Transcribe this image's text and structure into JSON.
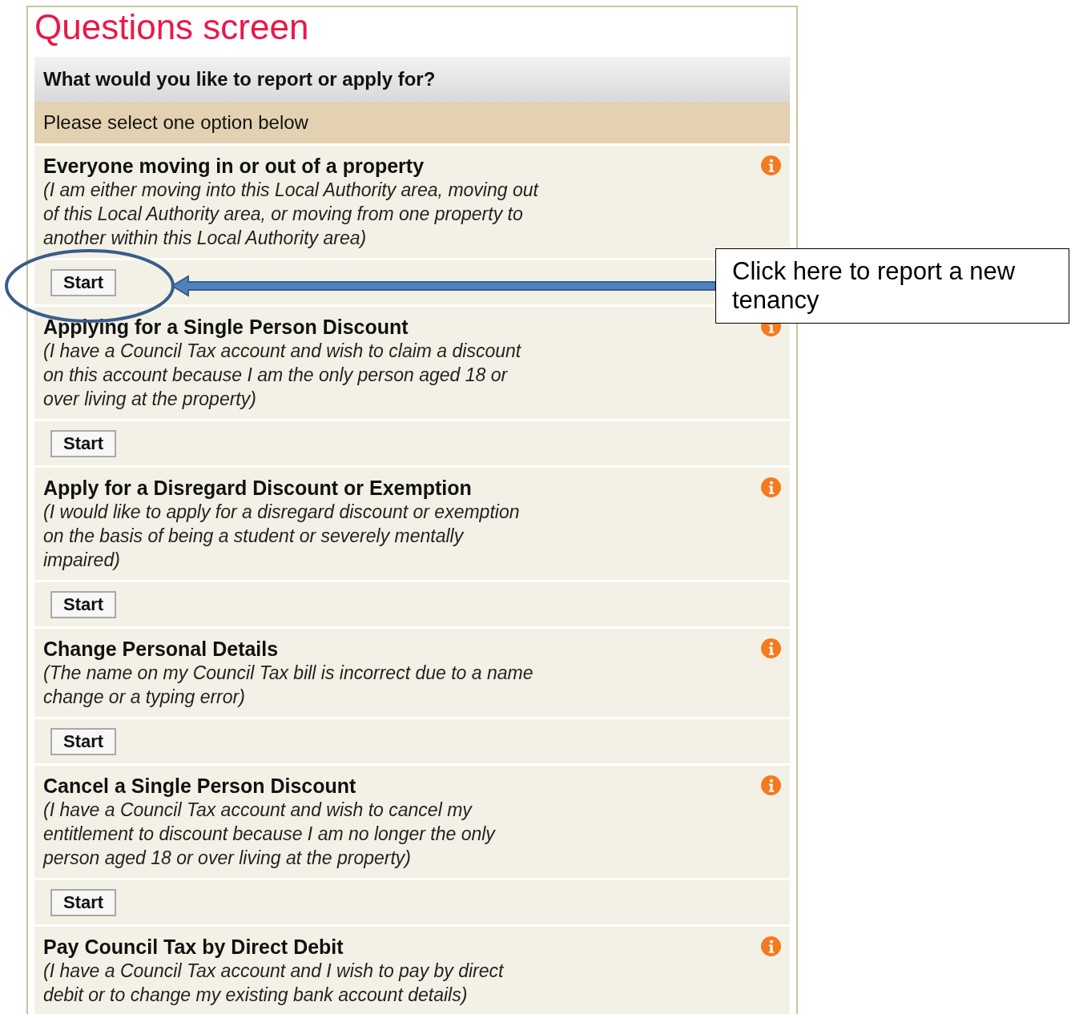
{
  "title": "Questions screen",
  "question": "What would you like to report or apply for?",
  "instruction": "Please select one option below",
  "options": [
    {
      "heading": "Everyone moving in or out of a property",
      "description": "(I am either moving into this Local Authority area, moving out of this Local Authority area, or moving from one property to another within this Local Authority area)",
      "button": "Start"
    },
    {
      "heading": "Applying for a Single Person Discount",
      "description": "(I have a Council Tax account and wish to claim a discount on this account because I am the only person aged 18 or over living at the property)",
      "button": "Start"
    },
    {
      "heading": "Apply for a Disregard Discount or Exemption",
      "description": "(I would like to apply for a disregard discount or exemption on the basis of being a student or severely mentally impaired)",
      "button": "Start"
    },
    {
      "heading": "Change Personal Details",
      "description": "(The name on my Council Tax bill is incorrect due to a name change or a typing error)",
      "button": "Start"
    },
    {
      "heading": "Cancel a Single Person Discount",
      "description": "(I have a Council Tax account and wish to cancel my entitlement to discount because I am no longer the only person aged 18 or over living at the property)",
      "button": "Start"
    },
    {
      "heading": "Pay Council Tax by Direct Debit",
      "description": "(I have a Council Tax account and I wish to pay by direct debit or to change my existing bank account details)"
    }
  ],
  "callout": {
    "text": "Click here to report a new tenancy"
  }
}
